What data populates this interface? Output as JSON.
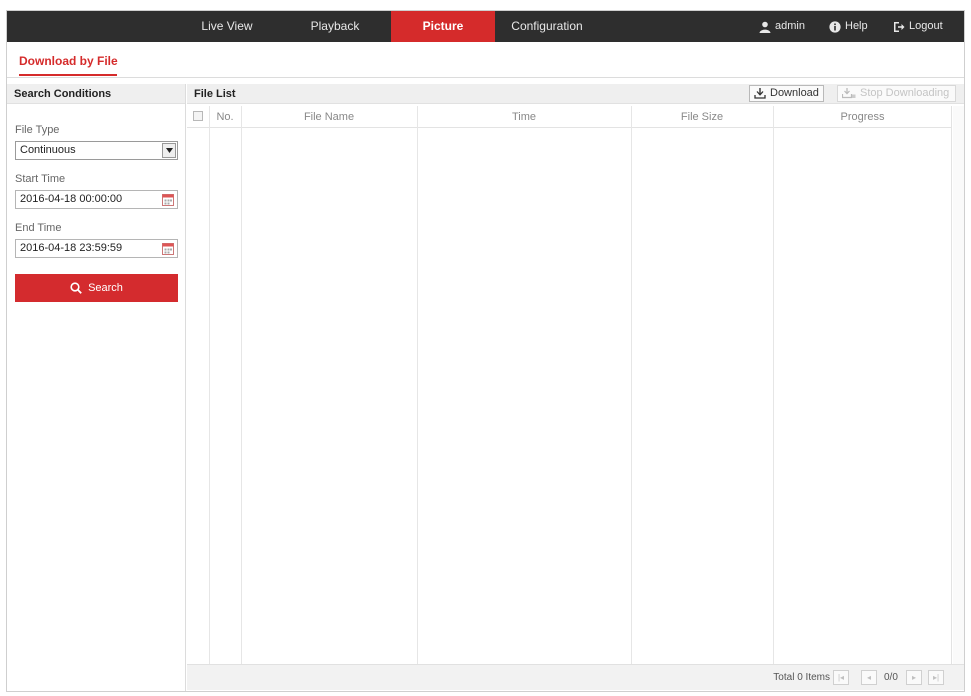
{
  "nav": {
    "items": [
      {
        "label": "Live View"
      },
      {
        "label": "Playback"
      },
      {
        "label": "Picture"
      },
      {
        "label": "Configuration"
      }
    ],
    "active": "Picture",
    "user": "admin",
    "help": "Help",
    "logout": "Logout"
  },
  "page": {
    "tab": "Download by File"
  },
  "search": {
    "title": "Search Conditions",
    "file_type_label": "File Type",
    "file_type_value": "Continuous",
    "start_time_label": "Start Time",
    "start_time_value": "2016-04-18 00:00:00",
    "end_time_label": "End Time",
    "end_time_value": "2016-04-18 23:59:59",
    "search_button": "Search"
  },
  "file_list": {
    "title": "File List",
    "download_button": "Download",
    "stop_button": "Stop Downloading",
    "columns": [
      "No.",
      "File Name",
      "Time",
      "File Size",
      "Progress"
    ],
    "rows": [],
    "total": "Total 0 Items",
    "page_indicator": "0/0",
    "pager": {
      "first": "|◂",
      "prev": "◂",
      "next": "▸",
      "last": "▸|"
    }
  },
  "colors": {
    "accent": "#d52b2b",
    "topbar": "#2e2e2e"
  }
}
